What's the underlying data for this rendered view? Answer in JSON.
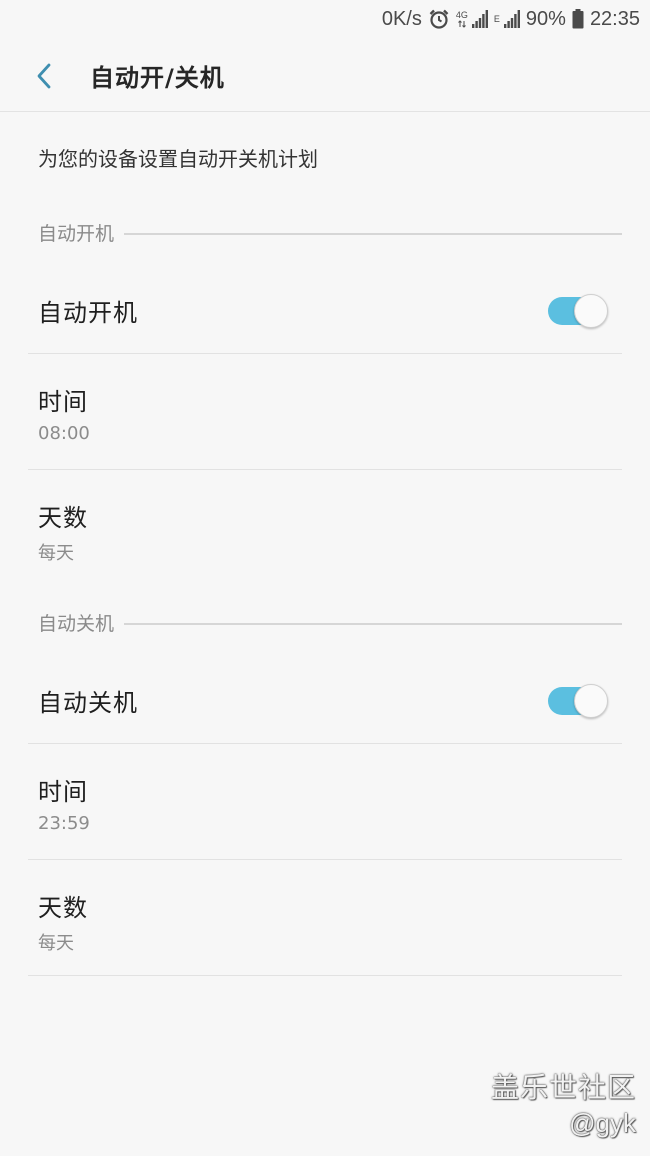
{
  "status_bar": {
    "net_speed": "0K/s",
    "net_4g": "4G",
    "net_e": "E",
    "battery": "90%",
    "time": "22:35"
  },
  "header": {
    "title": "自动开/关机"
  },
  "description": "为您的设备设置自动开关机计划",
  "power_on": {
    "section_label": "自动开机",
    "toggle_label": "自动开机",
    "toggle_on": true,
    "time_label": "时间",
    "time_value": "08:00",
    "days_label": "天数",
    "days_value": "每天"
  },
  "power_off": {
    "section_label": "自动关机",
    "toggle_label": "自动关机",
    "toggle_on": true,
    "time_label": "时间",
    "time_value": "23:59",
    "days_label": "天数",
    "days_value": "每天"
  },
  "watermark": {
    "line1": "盖乐世社区",
    "line2": "@gyk"
  },
  "colors": {
    "toggle_accent": "#5bbfe0",
    "back_arrow": "#3f8fb0",
    "background": "#f7f7f7"
  }
}
